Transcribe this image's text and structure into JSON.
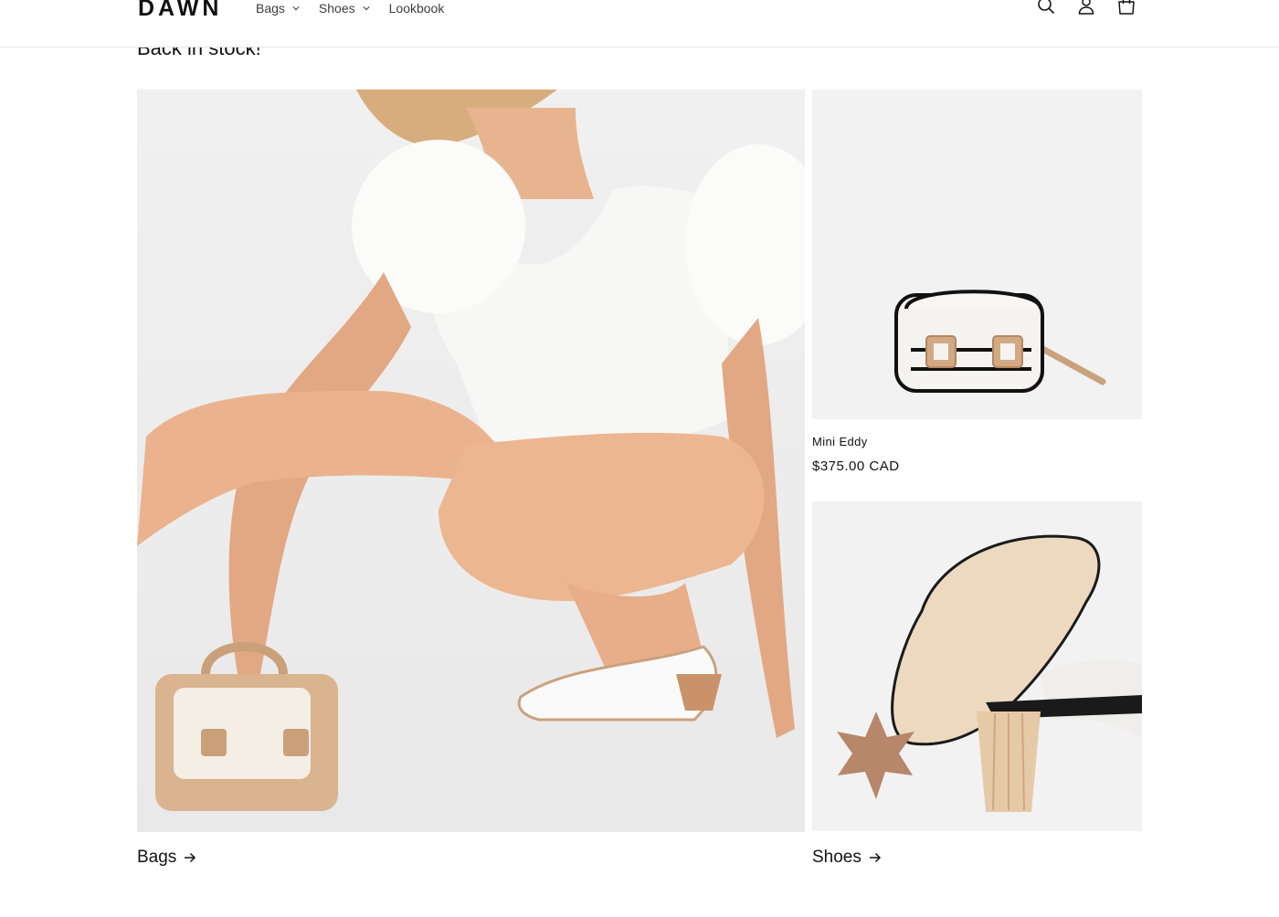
{
  "header": {
    "logo": "DAWN",
    "nav": [
      {
        "label": "Bags",
        "has_dropdown": true
      },
      {
        "label": "Shoes",
        "has_dropdown": true
      },
      {
        "label": "Lookbook",
        "has_dropdown": false
      }
    ],
    "icons": [
      "search-icon",
      "account-icon",
      "cart-icon"
    ]
  },
  "section": {
    "title": "Back in stock!"
  },
  "products": [
    {
      "title": "Mini Eddy",
      "price": "$375.00 CAD"
    }
  ],
  "collections": [
    {
      "label": "Bags"
    },
    {
      "label": "Shoes"
    }
  ],
  "colors": {
    "text": "#121212",
    "image_bg": "#f2f2f2",
    "border": "#e6e6e6",
    "tan": "#c9a27c"
  }
}
